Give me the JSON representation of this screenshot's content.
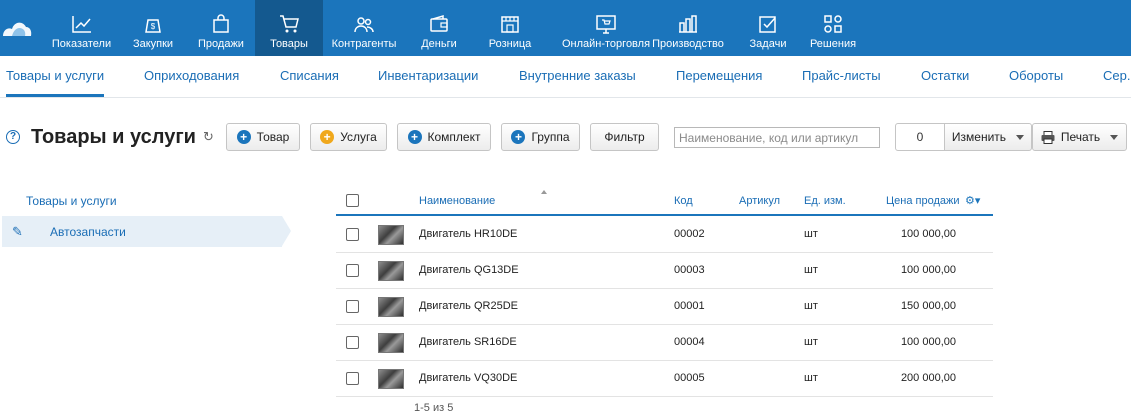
{
  "topnav": {
    "items": [
      {
        "label": "Показатели",
        "icon": "chart-line-icon"
      },
      {
        "label": "Закупки",
        "icon": "bag-dollar-icon"
      },
      {
        "label": "Продажи",
        "icon": "shopping-bag-icon"
      },
      {
        "label": "Товары",
        "icon": "cart-icon",
        "active": true
      },
      {
        "label": "Контрагенты",
        "icon": "people-icon"
      },
      {
        "label": "Деньги",
        "icon": "wallet-icon"
      },
      {
        "label": "Розница",
        "icon": "store-icon"
      },
      {
        "label": "Онлайн-торговля",
        "icon": "online-store-icon"
      },
      {
        "label": "Производство",
        "icon": "factory-icon"
      },
      {
        "label": "Задачи",
        "icon": "checkbox-icon"
      },
      {
        "label": "Решения",
        "icon": "apps-icon"
      }
    ]
  },
  "subnav": {
    "items": [
      "Товары и услуги",
      "Оприходования",
      "Списания",
      "Инвентаризации",
      "Внутренние заказы",
      "Перемещения",
      "Прайс-листы",
      "Остатки",
      "Обороты",
      "Сер..."
    ]
  },
  "toolbar": {
    "title": "Товары и услуги",
    "buttons": {
      "product": "Товар",
      "service": "Услуга",
      "kit": "Комплект",
      "group": "Группа",
      "filter": "Фильтр"
    },
    "search_placeholder": "Наименование, код или артикул",
    "count": "0",
    "change": "Изменить",
    "print": "Печать"
  },
  "tree": {
    "root": "Товары и услуги",
    "selected": "Автозапчасти"
  },
  "table": {
    "headers": {
      "name": "Наименование",
      "code": "Код",
      "article": "Артикул",
      "unit": "Ед. изм.",
      "price": "Цена продажи"
    },
    "rows": [
      {
        "name": "Двигатель HR10DE",
        "code": "00002",
        "article": "",
        "unit": "шт",
        "price": "100 000,00"
      },
      {
        "name": "Двигатель QG13DE",
        "code": "00003",
        "article": "",
        "unit": "шт",
        "price": "100 000,00"
      },
      {
        "name": "Двигатель QR25DE",
        "code": "00001",
        "article": "",
        "unit": "шт",
        "price": "150 000,00"
      },
      {
        "name": "Двигатель SR16DE",
        "code": "00004",
        "article": "",
        "unit": "шт",
        "price": "100 000,00"
      },
      {
        "name": "Двигатель VQ30DE",
        "code": "00005",
        "article": "",
        "unit": "шт",
        "price": "200 000,00"
      }
    ]
  },
  "pager": {
    "range": "1-5 из 5"
  },
  "colors": {
    "brand": "#1b75bc",
    "active_nav": "#14598f",
    "link": "#1a6db5",
    "add_orange": "#f0a81c"
  }
}
